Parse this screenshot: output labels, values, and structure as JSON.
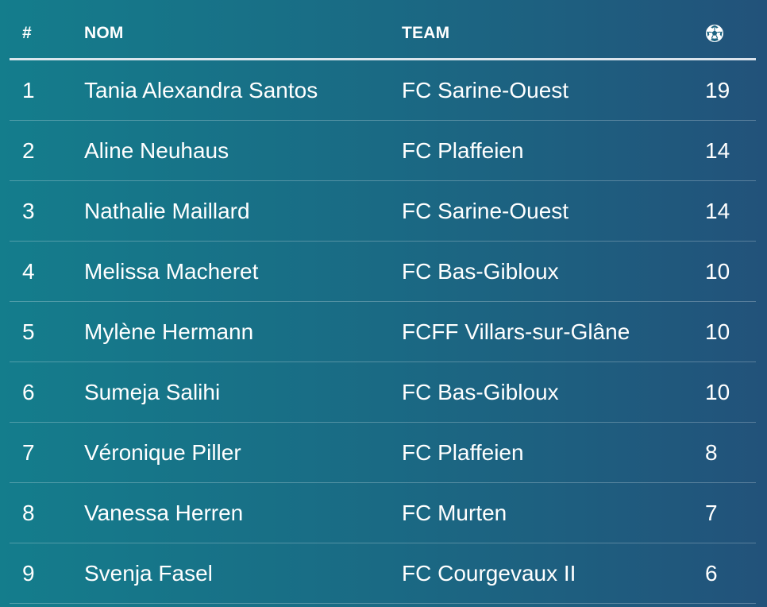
{
  "table": {
    "headers": {
      "rank": "#",
      "name": "NOM",
      "team": "TEAM",
      "goals_icon": "soccer-ball-icon"
    },
    "rows": [
      {
        "rank": "1",
        "name": "Tania Alexandra Santos",
        "team": "FC Sarine-Ouest",
        "goals": "19"
      },
      {
        "rank": "2",
        "name": "Aline Neuhaus",
        "team": "FC Plaffeien",
        "goals": "14"
      },
      {
        "rank": "3",
        "name": "Nathalie Maillard",
        "team": "FC Sarine-Ouest",
        "goals": "14"
      },
      {
        "rank": "4",
        "name": "Melissa Macheret",
        "team": "FC Bas-Gibloux",
        "goals": "10"
      },
      {
        "rank": "5",
        "name": "Mylène Hermann",
        "team": "FCFF Villars-sur-Glâne",
        "goals": "10"
      },
      {
        "rank": "6",
        "name": "Sumeja Salihi",
        "team": "FC Bas-Gibloux",
        "goals": "10"
      },
      {
        "rank": "7",
        "name": "Véronique Piller",
        "team": "FC Plaffeien",
        "goals": "8"
      },
      {
        "rank": "8",
        "name": "Vanessa Herren",
        "team": "FC Murten",
        "goals": "7"
      },
      {
        "rank": "9",
        "name": "Svenja Fasel",
        "team": "FC Courgevaux II",
        "goals": "6"
      }
    ]
  },
  "colors": {
    "background_start": "#147d8c",
    "background_end": "#22527a",
    "text": "#ffffff"
  }
}
